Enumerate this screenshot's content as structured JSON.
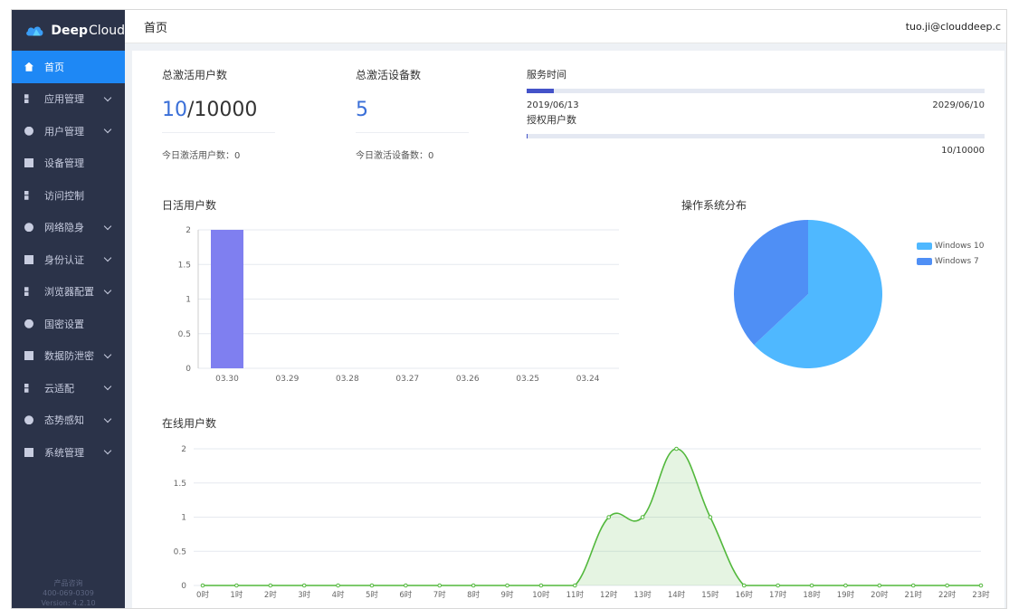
{
  "brand": {
    "name_bold": "Deep",
    "name_light": "Cloud"
  },
  "header": {
    "title": "首页",
    "user": "tuo.ji@clouddeep.c"
  },
  "sidebar": {
    "items": [
      {
        "label": "首页",
        "icon": "home-icon",
        "active": true,
        "expandable": false
      },
      {
        "label": "应用管理",
        "icon": "grid-icon",
        "expandable": true
      },
      {
        "label": "用户管理",
        "icon": "user-icon",
        "expandable": true
      },
      {
        "label": "设备管理",
        "icon": "device-icon",
        "expandable": false
      },
      {
        "label": "访问控制",
        "icon": "access-icon",
        "expandable": false
      },
      {
        "label": "网络隐身",
        "icon": "shield-icon",
        "expandable": true
      },
      {
        "label": "身份认证",
        "icon": "identity-icon",
        "expandable": true
      },
      {
        "label": "浏览器配置",
        "icon": "browser-icon",
        "expandable": true
      },
      {
        "label": "国密设置",
        "icon": "crypto-icon",
        "expandable": false
      },
      {
        "label": "数据防泄密",
        "icon": "data-icon",
        "expandable": true
      },
      {
        "label": "云适配",
        "icon": "cloud-adapt-icon",
        "expandable": true
      },
      {
        "label": "态势感知",
        "icon": "monitor-icon",
        "expandable": true
      },
      {
        "label": "系统管理",
        "icon": "gear-icon",
        "expandable": true
      }
    ],
    "footer": {
      "line1": "产品咨询",
      "line2": "400-069-0309",
      "line3": "Version: 4.2.10"
    }
  },
  "stats": {
    "total_users": {
      "label": "总激活用户数",
      "value": "10",
      "total": "/10000",
      "today": "今日激活用户数：0"
    },
    "total_devices": {
      "label": "总激活设备数",
      "value": "5",
      "today": "今日激活设备数：0"
    }
  },
  "service": {
    "label": "服务时间",
    "start": "2019/06/13",
    "end": "2029/06/10",
    "progress": 0.06,
    "auth_label": "授权用户数",
    "auth_value": "10/10000",
    "auth_progress": 0.001
  },
  "sections": {
    "daily": "日活用户数",
    "os": "操作系统分布",
    "online": "在线用户数"
  },
  "colors": {
    "accent": "#1e88f5",
    "bar": "#7f7ff0",
    "line": "#52b83c",
    "win10": "#4fb8ff",
    "win7": "#4f8ff5",
    "sidebar": "#2b3349"
  },
  "chart_data": [
    {
      "type": "bar",
      "title": "日活用户数",
      "categories": [
        "03.30",
        "03.29",
        "03.28",
        "03.27",
        "03.26",
        "03.25",
        "03.24"
      ],
      "values": [
        2,
        0,
        0,
        0,
        0,
        0,
        0
      ],
      "ylim": [
        0,
        2
      ],
      "yticks": [
        "0",
        "0.5",
        "1",
        "1.5",
        "2"
      ],
      "grid": true
    },
    {
      "type": "pie",
      "title": "操作系统分布",
      "labels": [
        "Windows 10",
        "Windows 7"
      ],
      "values": [
        63,
        37
      ],
      "legend": "top-right"
    },
    {
      "type": "area",
      "title": "在线用户数",
      "categories": [
        "0时",
        "1时",
        "2时",
        "3时",
        "4时",
        "5时",
        "6时",
        "7时",
        "8时",
        "9时",
        "10时",
        "11时",
        "12时",
        "13时",
        "14时",
        "15时",
        "16时",
        "17时",
        "18时",
        "19时",
        "20时",
        "21时",
        "22时",
        "23时"
      ],
      "values": [
        0,
        0,
        0,
        0,
        0,
        0,
        0,
        0,
        0,
        0,
        0,
        0,
        1,
        1,
        2,
        1,
        0,
        0,
        0,
        0,
        0,
        0,
        0,
        0
      ],
      "ylim": [
        0,
        2
      ],
      "yticks": [
        "0",
        "0.5",
        "1",
        "1.5",
        "2"
      ],
      "grid": true
    }
  ]
}
